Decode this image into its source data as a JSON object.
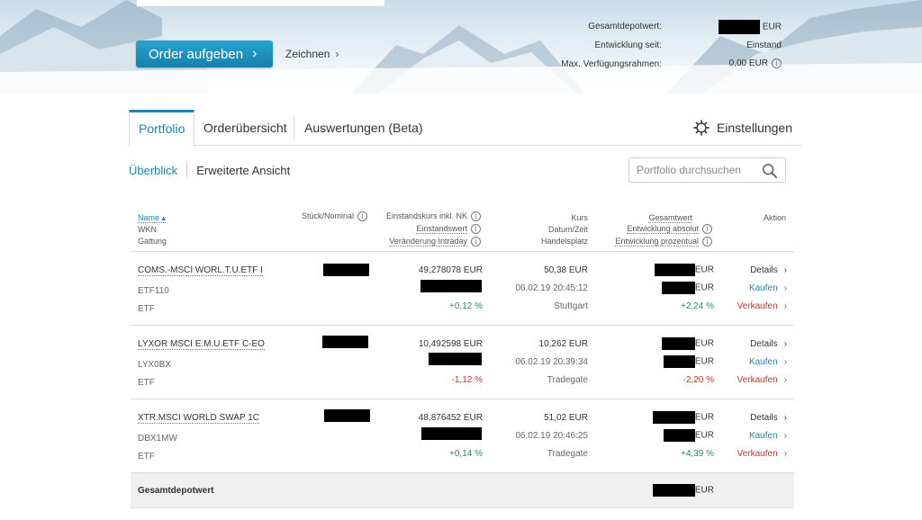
{
  "header": {
    "order_button": "Order aufgeben",
    "order_chevron": "›",
    "draw_link": "Zeichnen",
    "summary": {
      "total_label": "Gesamtdepotwert:",
      "total_currency": "EUR",
      "since_label": "Entwicklung seit:",
      "since_value": "Einstand",
      "max_label": "Max. Verfügungsrahmen:",
      "max_value": "0,00 EUR"
    }
  },
  "tabs": [
    {
      "label": "Portfolio"
    },
    {
      "label": "Orderübersicht"
    },
    {
      "label": "Auswertungen (Beta)"
    }
  ],
  "settings_label": "Einstellungen",
  "subnav": {
    "overview": "Überblick",
    "extended": "Erweiterte Ansicht"
  },
  "search": {
    "placeholder": "Portfolio durchsuchen"
  },
  "table": {
    "headers": {
      "name": "Name ▴",
      "wkn": "WKN",
      "gattung": "Gattung",
      "stueck": "Stück/Nominal",
      "einstandskurs": "Einstandskurs inkl. NK",
      "einstandswert": "Einstandswert",
      "veraenderung": "Veränderung Intraday",
      "kurs": "Kurs",
      "datum": "Datum/Zeit",
      "handelsplatz": "Handelsplatz",
      "gesamtwert": "Gesamtwert",
      "entw_abs": "Entwicklung absolut",
      "entw_proz": "Entwicklung prozentual",
      "aktion": "Aktion"
    },
    "rows": [
      {
        "name": "COMS.-MSCI WORL.T.U.ETF I",
        "wkn": "ETF110",
        "gattung": "ETF",
        "einstandskurs": "49,278078 EUR",
        "intraday": "+0,12 %",
        "kurs": "50,38 EUR",
        "datum": "06.02.19 20:45:12",
        "handelsplatz": "Stuttgart",
        "gesamt_currency": "EUR",
        "abs_currency": "EUR",
        "prozent": "+2,24 %"
      },
      {
        "name": "LYXOR MSCI E.M.U.ETF C-EO",
        "wkn": "LYX0BX",
        "gattung": "ETF",
        "einstandskurs": "10,492598 EUR",
        "intraday": "-1,12 %",
        "kurs": "10,262 EUR",
        "datum": "06.02.19 20:39:34",
        "handelsplatz": "Tradegate",
        "gesamt_currency": "EUR",
        "abs_currency": "EUR",
        "prozent": "-2,20 %"
      },
      {
        "name": "XTR.MSCI WORLD SWAP 1C",
        "wkn": "DBX1MW",
        "gattung": "ETF",
        "einstandskurs": "48,876452 EUR",
        "intraday": "+0,14 %",
        "kurs": "51,02 EUR",
        "datum": "06.02.19 20:46:25",
        "handelsplatz": "Tradegate",
        "gesamt_currency": "EUR",
        "abs_currency": "EUR",
        "prozent": "+4,39 %"
      }
    ],
    "actions": {
      "details": "Details",
      "buy": "Kaufen",
      "sell": "Verkaufen",
      "chevron": "›"
    },
    "total": {
      "label": "Gesamtdepotwert",
      "currency": "EUR"
    }
  },
  "colors": {
    "accent": "#1d85b5",
    "positive": "#2e8b57",
    "negative": "#c0392b",
    "redacted": "#000000"
  },
  "icons": {
    "settings": "gear-icon",
    "search": "search-icon",
    "info": "info-icon"
  }
}
